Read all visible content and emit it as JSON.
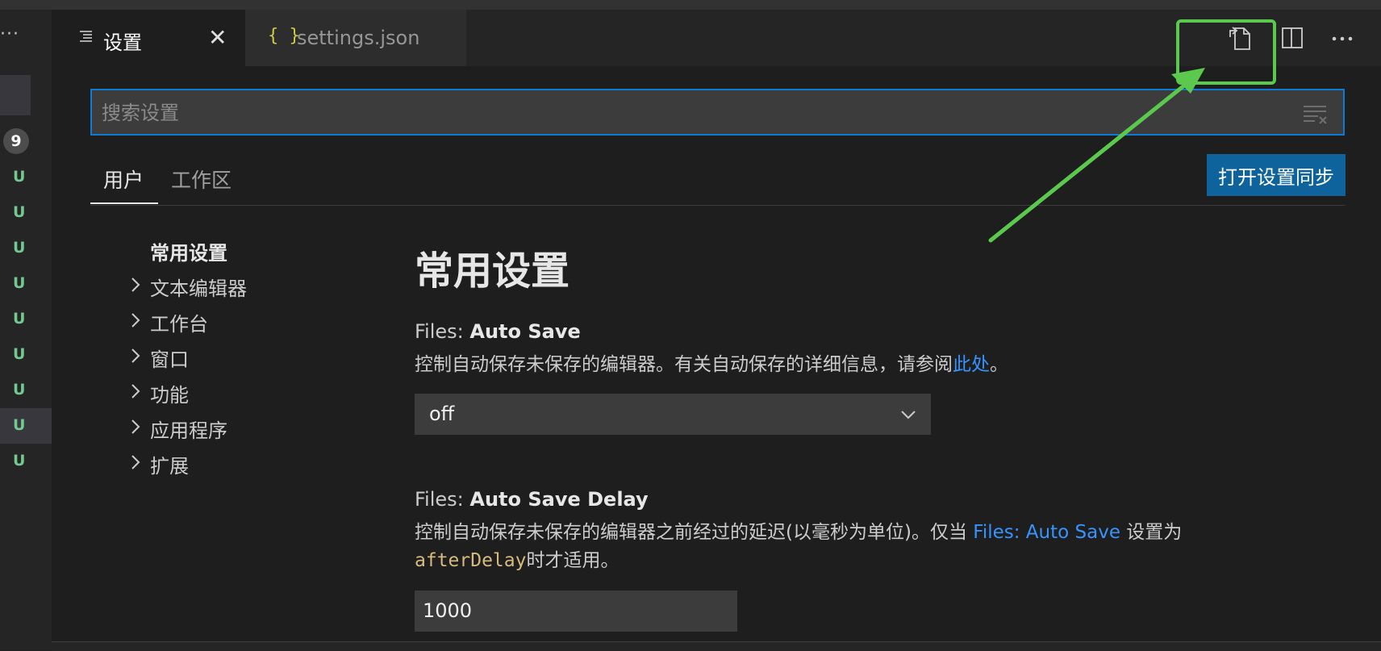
{
  "left_panel": {
    "more_label": "···",
    "badge": "9",
    "status_letters": [
      "U",
      "U",
      "U",
      "U",
      "U",
      "U",
      "U",
      "U",
      "U"
    ]
  },
  "tabs": {
    "settings": {
      "label": "设置",
      "icon": "lines-icon",
      "close": "✕"
    },
    "json": {
      "label": "settings.json",
      "icon": "{ }"
    }
  },
  "editor_actions": [
    "open-settings-json-icon",
    "split-editor-icon",
    "more-actions-icon"
  ],
  "search": {
    "placeholder": "搜索设置",
    "value": ""
  },
  "scope_tabs": {
    "user": "用户",
    "workspace": "工作区"
  },
  "sync_button": "打开设置同步",
  "toc": {
    "common": "常用设置",
    "items": [
      "文本编辑器",
      "工作台",
      "窗口",
      "功能",
      "应用程序",
      "扩展"
    ]
  },
  "section_title": "常用设置",
  "settings": {
    "auto_save": {
      "category": "Files: ",
      "name": "Auto Save",
      "desc_before": "控制自动保存未保存的编辑器。有关自动保存的详细信息，请参阅",
      "desc_link": "此处",
      "desc_after": "。",
      "value": "off"
    },
    "auto_save_delay": {
      "category": "Files: ",
      "name": "Auto Save Delay",
      "desc_before": "控制自动保存未保存的编辑器之前经过的延迟(以毫秒为单位)。仅当 ",
      "desc_link": "Files: Auto Save",
      "desc_mid": " 设置为",
      "desc_code": "afterDelay",
      "desc_after": "时才适用。",
      "value": "1000"
    }
  },
  "colors": {
    "accent_highlight": "#5ac94d",
    "focus_border": "#0e7ad4",
    "button": "#0e639c",
    "link": "#3794ff",
    "untracked": "#73c991"
  }
}
